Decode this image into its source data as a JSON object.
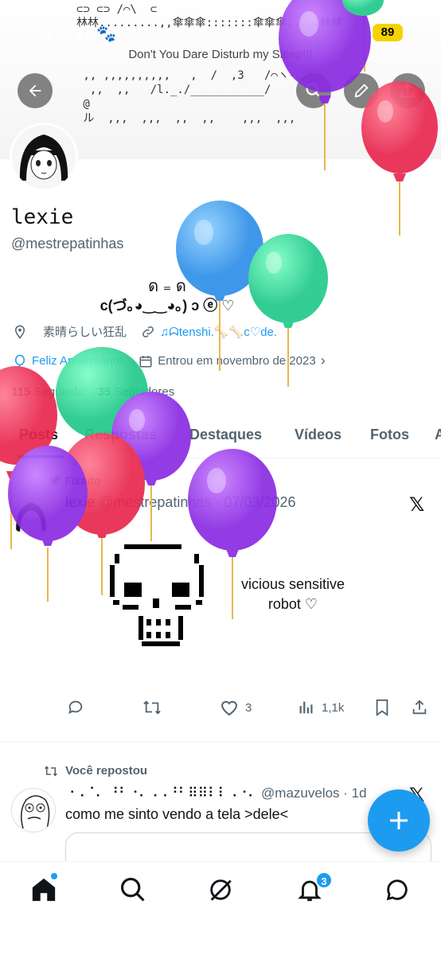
{
  "status_bar": {
    "time": "12:17",
    "battery": "89",
    "paw": "🐾"
  },
  "banner": {
    "art_top": "⊂⊃ ⊂⊃ /⌒\\  ⊂\n林林.........,,傘傘傘:::::::傘傘傘.....林林",
    "subtitle": "Don't You Dare Disturb my Sleep!!!",
    "art_bottom": " ,, ,,,,,,,,,,   ,  /  ,3   /⌒ヽ-、_\n  ,,  ,,   /l._./___________/\n @ \n ル  ,,,  ,,,  ,,  ,,    ,,,  ,,,"
  },
  "profile": {
    "display_name": "lexie",
    "handle": "@mestrepatinhas",
    "bio_line1": "ด ₌ ด",
    "bio_line2": "c(づ｡◕‿‿◕｡) ↄ ⓔ ♡",
    "location": "素晴らしい狂乱",
    "link": "♫ᗣtenshi.🦴🦴c♡de.",
    "birthday": "Feliz Aniversário!",
    "joined": "Entrou em novembro de 2023",
    "following_count": "115",
    "following_label": "Seguindo",
    "followers_count": "35",
    "followers_label": "Seguidores"
  },
  "tabs": [
    "Posts",
    "Respostas",
    "Destaques",
    "Vídeos",
    "Fotos",
    "A"
  ],
  "pinned_post": {
    "pinned_label": "Fixado",
    "name": "lexie",
    "handle": "@mestrepatinhas",
    "date": "· 07/03/2026",
    "text_line1": "vicious sensitive",
    "text_line2": "robot ♡",
    "likes": "3",
    "views": "1,1k"
  },
  "repost": {
    "label": "Você repostou",
    "name": "⠐⠠⠈⠄ ⠘⠃⠐⠄⠠⠠⠘⠃⠿⠿⠇⠇⠠⠐⠄",
    "handle": "@mazuvelos",
    "date": "· 1d",
    "text": "como me sinto vendo a tela >dele<"
  },
  "bottom_nav": {
    "notifications_badge": "3"
  },
  "colors": {
    "accent": "#1d9bf0",
    "text": "#0f1419",
    "muted": "#536471"
  }
}
